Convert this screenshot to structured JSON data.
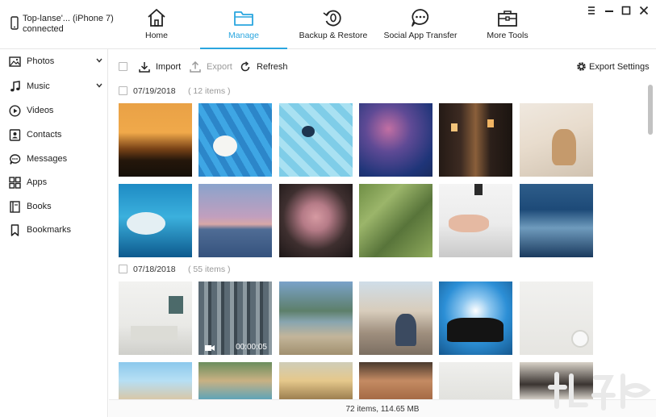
{
  "device": {
    "name": "Top-lanse'... (iPhone 7)",
    "status": "connected"
  },
  "nav": {
    "tabs": [
      {
        "label": "Home",
        "icon": "home-icon"
      },
      {
        "label": "Manage",
        "icon": "folder-icon",
        "active": true
      },
      {
        "label": "Backup & Restore",
        "icon": "backup-restore-icon"
      },
      {
        "label": "Social App Transfer",
        "icon": "chat-bubble-icon"
      },
      {
        "label": "More Tools",
        "icon": "toolbox-icon"
      }
    ],
    "accent_color": "#2aa6df"
  },
  "sidebar": {
    "items": [
      {
        "label": "Photos",
        "icon": "image-icon",
        "expandable": true
      },
      {
        "label": "Music",
        "icon": "music-note-icon",
        "expandable": true
      },
      {
        "label": "Videos",
        "icon": "play-icon"
      },
      {
        "label": "Contacts",
        "icon": "contact-icon"
      },
      {
        "label": "Messages",
        "icon": "message-icon"
      },
      {
        "label": "Apps",
        "icon": "apps-grid-icon"
      },
      {
        "label": "Books",
        "icon": "book-icon"
      },
      {
        "label": "Bookmarks",
        "icon": "bookmark-icon"
      }
    ]
  },
  "toolbar": {
    "import_label": "Import",
    "export_label": "Export",
    "refresh_label": "Refresh",
    "export_settings_label": "Export Settings"
  },
  "groups": [
    {
      "date": "07/19/2018",
      "count": "( 12 items )"
    },
    {
      "date": "07/18/2018",
      "count": "( 55 items )"
    }
  ],
  "video": {
    "duration": "00:00:05"
  },
  "status": {
    "summary": "72 items, 114.65 MB"
  }
}
